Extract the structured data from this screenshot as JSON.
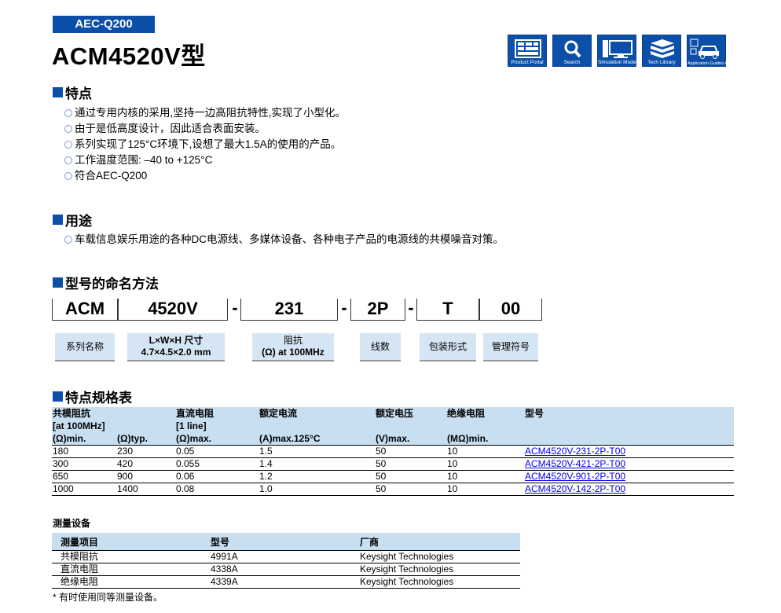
{
  "badge": "AEC-Q200",
  "title": "ACM4520V型",
  "nav": [
    {
      "label": "Product Portal",
      "icon": "product-portal-icon"
    },
    {
      "label": "Search",
      "icon": "search-icon"
    },
    {
      "label": "Simulation Model",
      "icon": "simulation-model-icon"
    },
    {
      "label": "Tech Library",
      "icon": "tech-library-icon"
    },
    {
      "label": "Application Guides Automotive",
      "icon": "automotive-guide-icon"
    }
  ],
  "features": {
    "heading": "特点",
    "items": [
      "通过专用内核的采用,坚持一边高阻抗特性,实现了小型化。",
      "由于是低高度设计，因此适合表面安装。",
      "系列实现了125°C环境下,设想了最大1.5A的使用的产品。",
      "工作温度范围: –40 to +125°C",
      "符合AEC-Q200"
    ]
  },
  "applications": {
    "heading": "用途",
    "items": [
      "车载信息娱乐用途的各种DC电源线、多媒体设备、各种电子产品的电源线的共模噪音对策。"
    ]
  },
  "part_number": {
    "heading": "型号的命名方法",
    "segments": [
      "ACM",
      "4520V",
      "231",
      "2P",
      "T",
      "00"
    ],
    "separator": "-",
    "labels": [
      {
        "l1": "系列名称",
        "l2": ""
      },
      {
        "l1": "L×W×H 尺寸",
        "l2": "4.7×4.5×2.0 mm"
      },
      {
        "l1": "阻抗",
        "l2": "(Ω) at 100MHz"
      },
      {
        "l1": "线数",
        "l2": ""
      },
      {
        "l1": "包装形式",
        "l2": ""
      },
      {
        "l1": "管理符号",
        "l2": ""
      }
    ]
  },
  "spec_table": {
    "heading": "特点规格表",
    "header_row1": [
      "共模阻抗",
      "",
      "直流电阻",
      "额定电流",
      "额定电压",
      "绝缘电阻",
      "型号"
    ],
    "header_row2": [
      "[at 100MHz]",
      "",
      "[1 line]",
      "",
      "",
      "",
      ""
    ],
    "header_row3": [
      "(Ω)min.",
      "(Ω)typ.",
      "(Ω)max.",
      "(A)max.125°C",
      "(V)max.",
      "(MΩ)min.",
      ""
    ],
    "rows": [
      [
        "180",
        "230",
        "0.05",
        "1.5",
        "50",
        "10",
        "ACM4520V-231-2P-T00"
      ],
      [
        "300",
        "420",
        "0.055",
        "1.4",
        "50",
        "10",
        "ACM4520V-421-2P-T00"
      ],
      [
        "650",
        "900",
        "0.06",
        "1.2",
        "50",
        "10",
        "ACM4520V-901-2P-T00"
      ],
      [
        "1000",
        "1400",
        "0.08",
        "1.0",
        "50",
        "10",
        "ACM4520V-142-2P-T00"
      ]
    ]
  },
  "measurement": {
    "heading": "测量设备",
    "headers": [
      "测量项目",
      "型号",
      "厂商"
    ],
    "rows": [
      [
        "共模阻抗",
        "4991A",
        "Keysight Technologies"
      ],
      [
        "直流电阻",
        "4338A",
        "Keysight Technologies"
      ],
      [
        "绝缘电阻",
        "4339A",
        "Keysight Technologies"
      ]
    ],
    "note": "*  有时使用同等测量设备。"
  },
  "colors": {
    "brand": "#0b4fa8",
    "table_header": "#c8dff1",
    "label_bg": "#d6e5f4",
    "link": "#0000ee"
  }
}
